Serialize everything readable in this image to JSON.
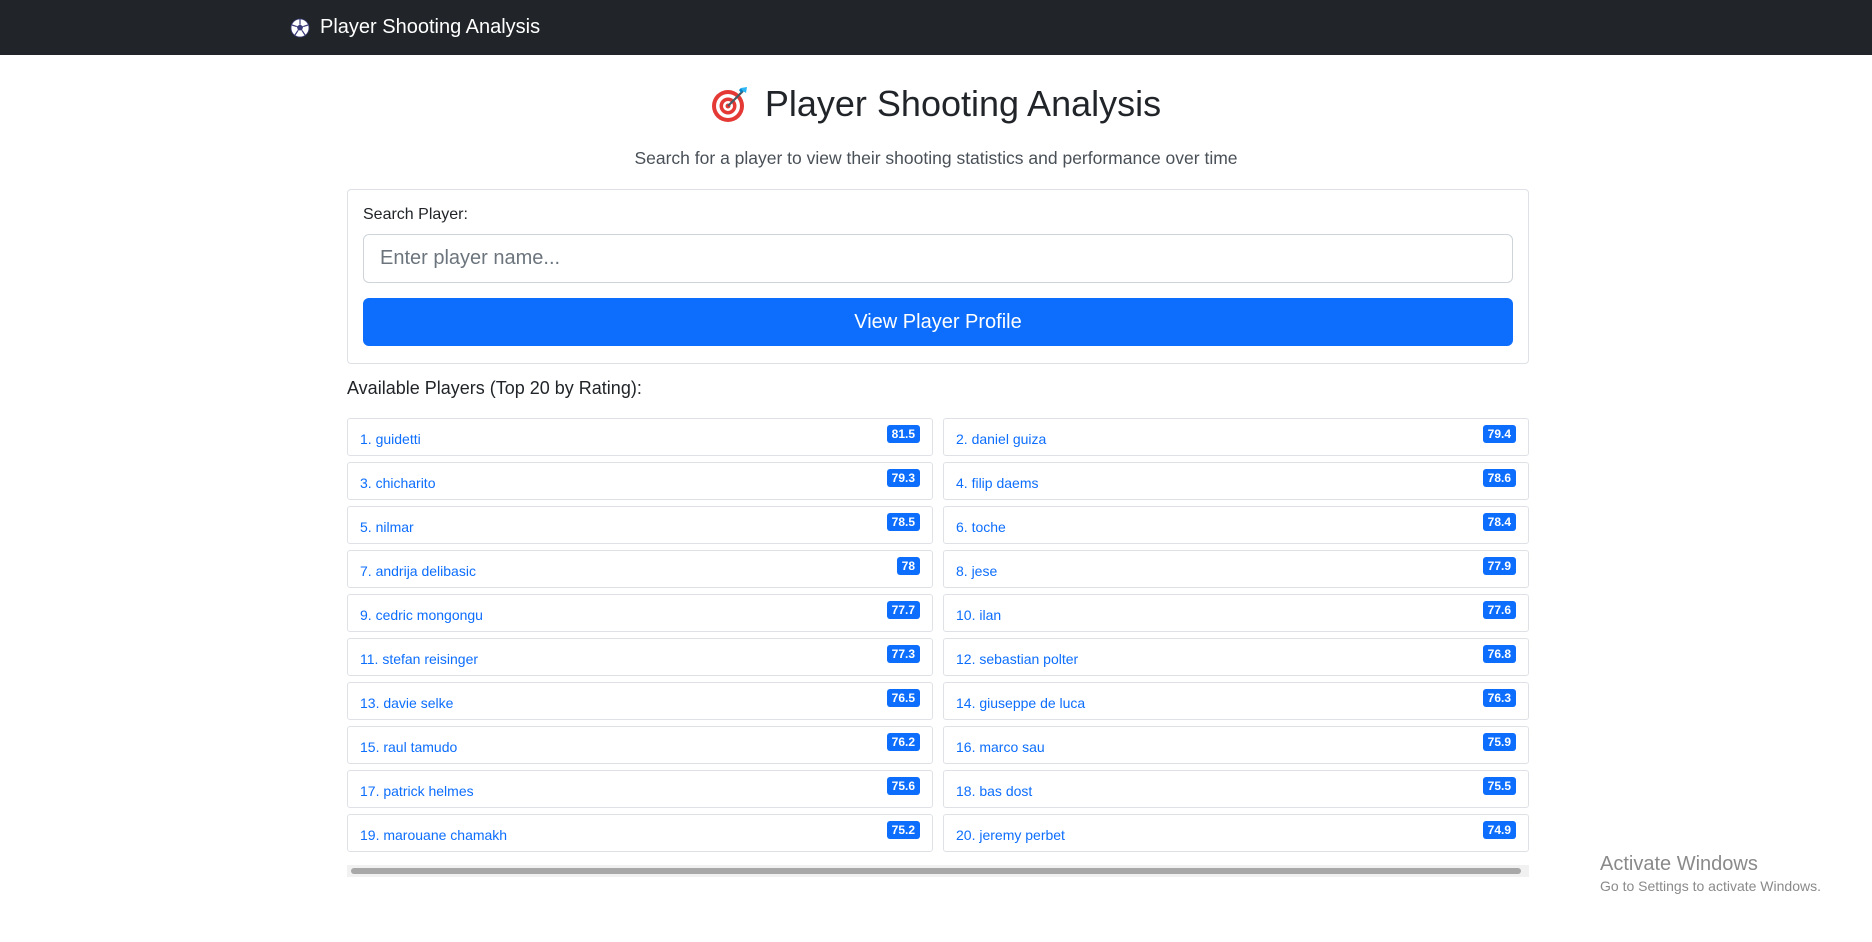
{
  "navbar": {
    "brand": "Player Shooting Analysis",
    "icon": "soccer-ball-icon"
  },
  "header": {
    "title": "Player Shooting Analysis",
    "title_icon": "target-icon",
    "subtitle": "Search for a player to view their shooting statistics and performance over time"
  },
  "search": {
    "label": "Search Player:",
    "placeholder": "Enter player name...",
    "value": "",
    "button_label": "View Player Profile"
  },
  "players_heading": "Available Players (Top 20 by Rating):",
  "players": [
    {
      "label": "1. guidetti",
      "rating": "81.5"
    },
    {
      "label": "2. daniel guiza",
      "rating": "79.4"
    },
    {
      "label": "3. chicharito",
      "rating": "79.3"
    },
    {
      "label": "4. filip daems",
      "rating": "78.6"
    },
    {
      "label": "5. nilmar",
      "rating": "78.5"
    },
    {
      "label": "6. toche",
      "rating": "78.4"
    },
    {
      "label": "7. andrija delibasic",
      "rating": "78"
    },
    {
      "label": "8. jese",
      "rating": "77.9"
    },
    {
      "label": "9. cedric mongongu",
      "rating": "77.7"
    },
    {
      "label": "10. ilan",
      "rating": "77.6"
    },
    {
      "label": "11. stefan reisinger",
      "rating": "77.3"
    },
    {
      "label": "12. sebastian polter",
      "rating": "76.8"
    },
    {
      "label": "13. davie selke",
      "rating": "76.5"
    },
    {
      "label": "14. giuseppe de luca",
      "rating": "76.3"
    },
    {
      "label": "15. raul tamudo",
      "rating": "76.2"
    },
    {
      "label": "16. marco sau",
      "rating": "75.9"
    },
    {
      "label": "17. patrick helmes",
      "rating": "75.6"
    },
    {
      "label": "18. bas dost",
      "rating": "75.5"
    },
    {
      "label": "19. marouane chamakh",
      "rating": "75.2"
    },
    {
      "label": "20. jeremy perbet",
      "rating": "74.9"
    }
  ],
  "watermark": {
    "title": "Activate Windows",
    "subtitle": "Go to Settings to activate Windows."
  },
  "colors": {
    "navbar": "#212529",
    "primary": "#0d6efd",
    "border": "#dee2e6"
  }
}
